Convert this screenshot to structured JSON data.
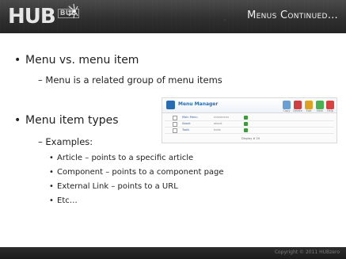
{
  "header": {
    "logo_text": "HUB",
    "logo_sub": "BUB",
    "title": "Menus Continued…"
  },
  "bullets": [
    {
      "text": "Menu vs. menu item",
      "sub": "– Menu is a related group of menu items"
    },
    {
      "text": "Menu item types",
      "sub": "– Examples:"
    }
  ],
  "examples": [
    "Article – points to a specific article",
    "Component – points to a component page",
    "External Link – points to a URL",
    "Etc…"
  ],
  "footer": {
    "copyright": "Copyright © 2011 HUBzero"
  },
  "screenshot": {
    "title": "Menu Manager",
    "toolbar": [
      "Copy",
      "Delete",
      "Edit",
      "New",
      "Help"
    ],
    "toolbar_colors": [
      "#6aa0d6",
      "#d04040",
      "#e0a020",
      "#4caf50",
      "#d94040"
    ],
    "rows": [
      {
        "col1": "Main Menu",
        "col2": "mainmenu",
        "col3": ""
      },
      {
        "col1": "About",
        "col2": "about",
        "col3": ""
      },
      {
        "col1": "Tools",
        "col2": "tools",
        "col3": ""
      }
    ],
    "footer": "Display # 20"
  }
}
